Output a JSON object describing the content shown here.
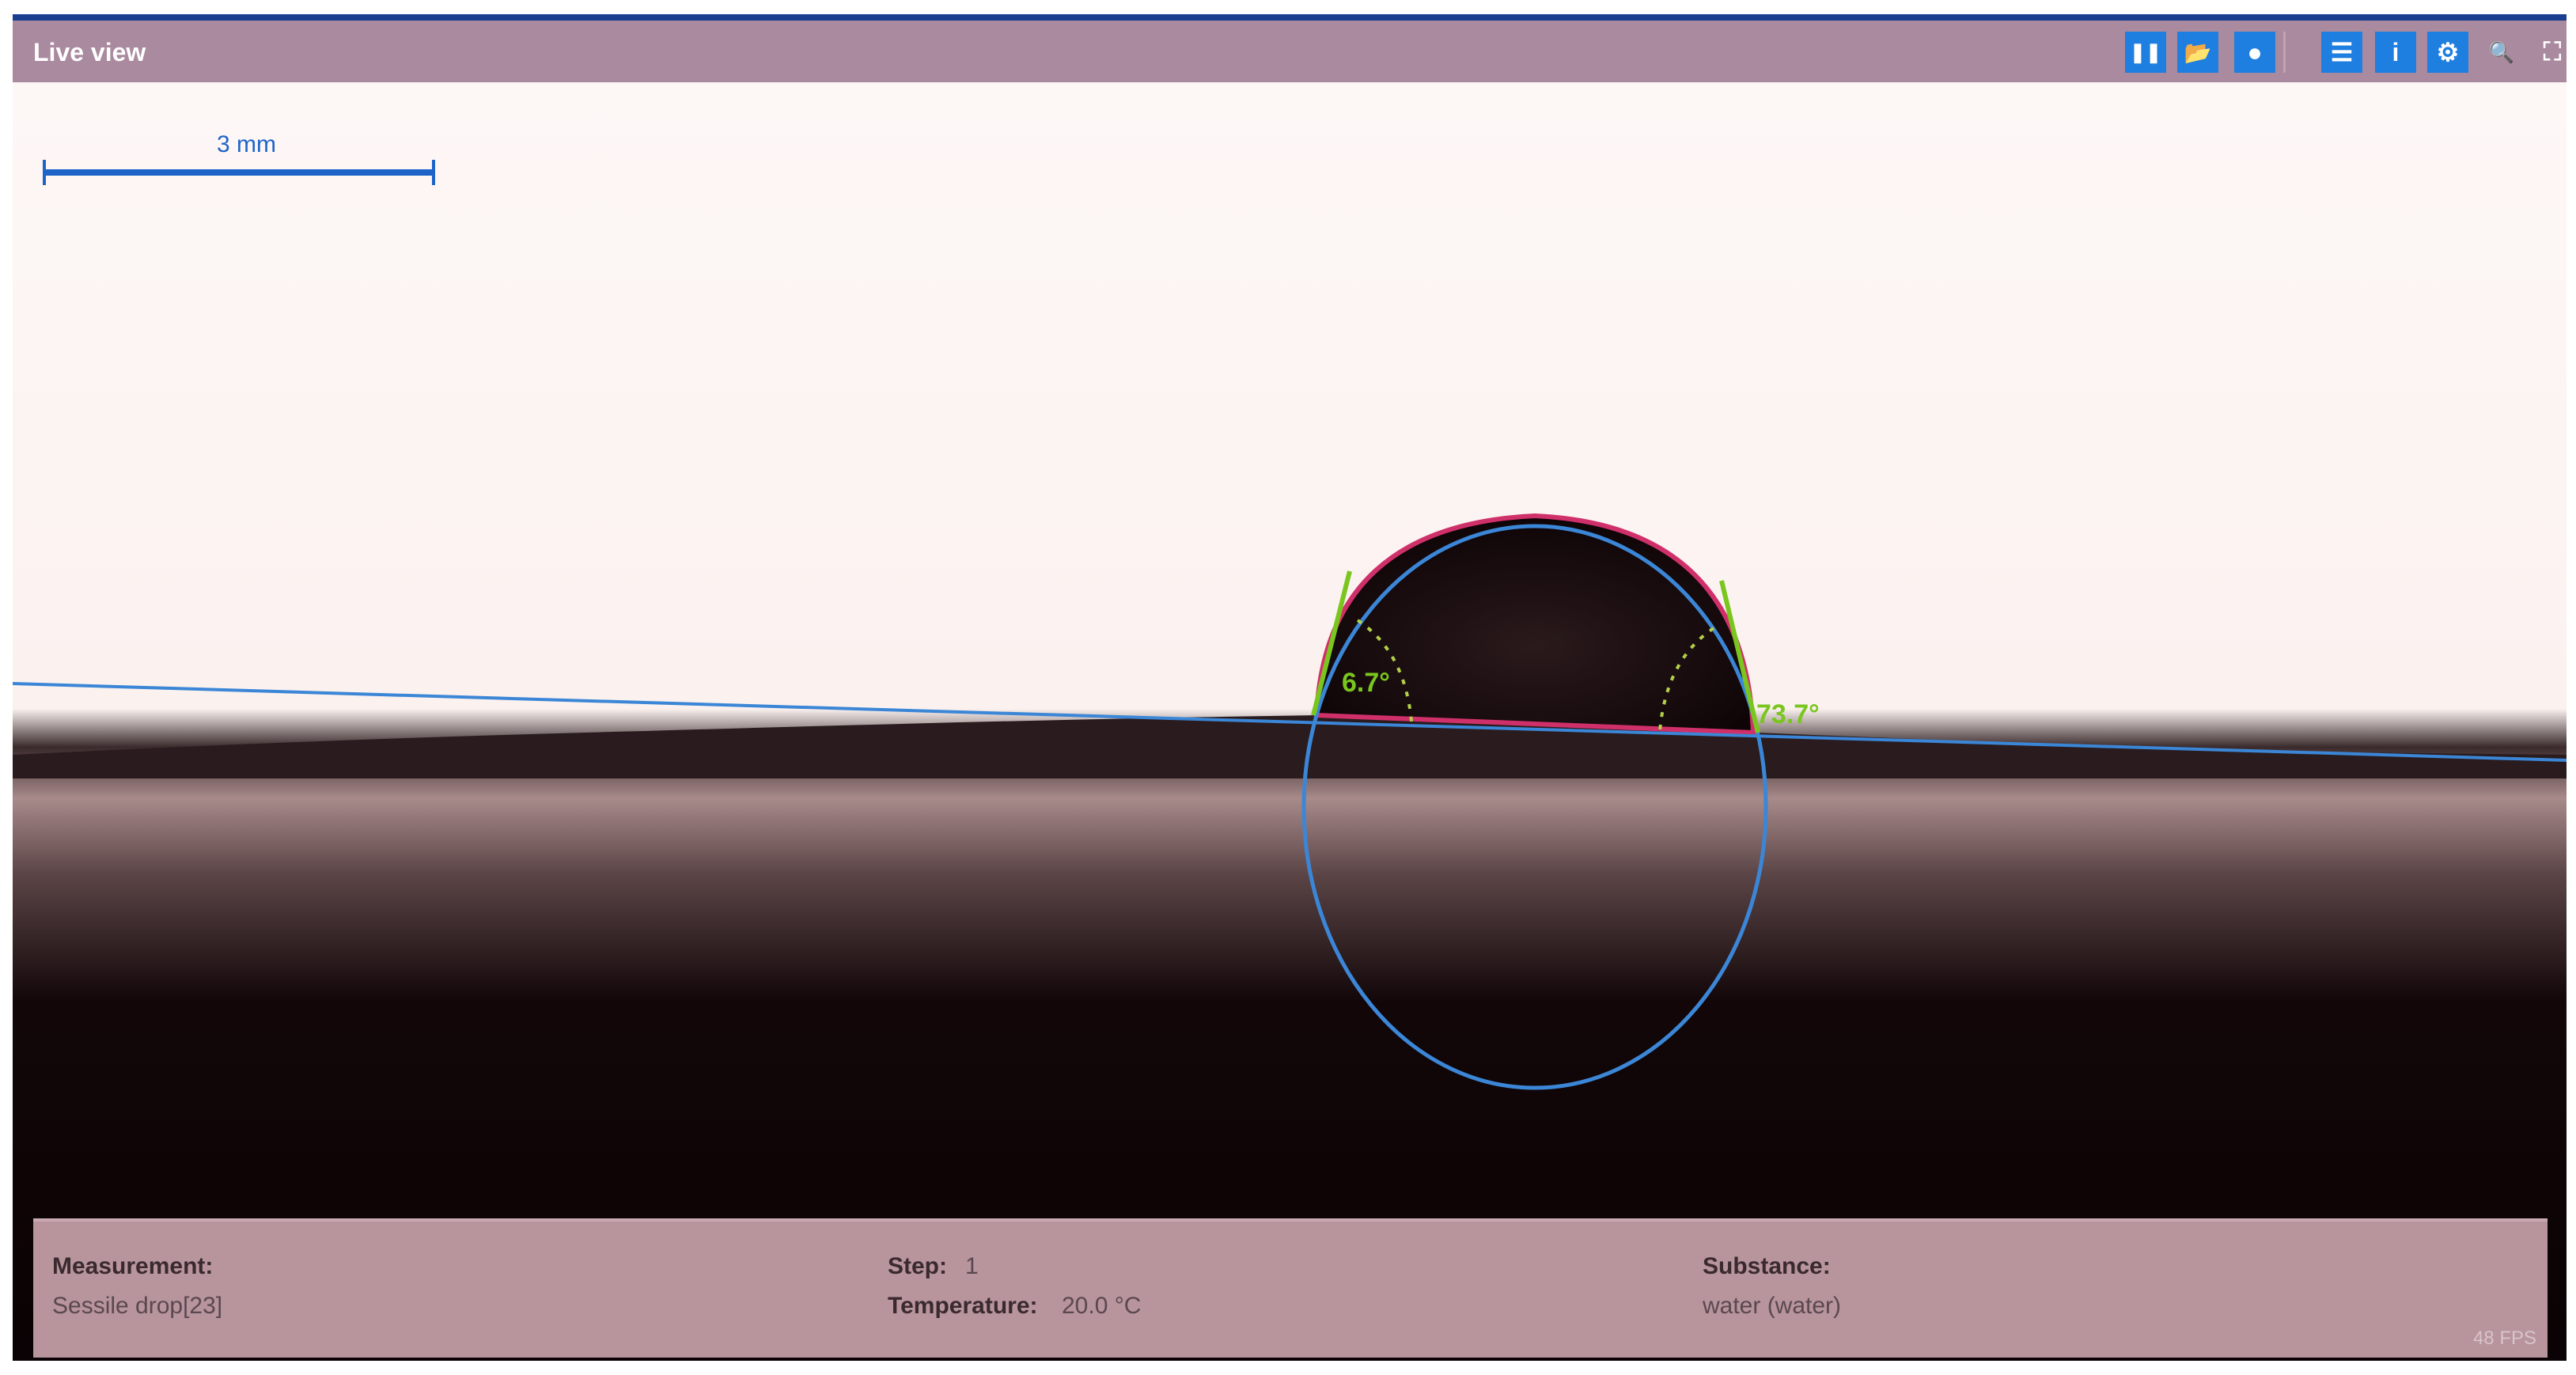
{
  "window": {
    "title": "Live view"
  },
  "toolbar": {
    "buttons": [
      {
        "icon": "pause-icon",
        "glyph": "❚❚"
      },
      {
        "icon": "open-folder-icon",
        "glyph": "📂"
      },
      {
        "icon": "record-icon",
        "glyph": "●"
      },
      {
        "icon": "baseline-icon",
        "glyph": "☰"
      },
      {
        "icon": "info-icon",
        "glyph": "i"
      },
      {
        "icon": "settings-gear-icon",
        "glyph": "⚙"
      },
      {
        "icon": "zoom-icon",
        "glyph": "🔍"
      },
      {
        "icon": "fit-screen-icon",
        "glyph": "⛶"
      }
    ]
  },
  "image": {
    "scale_bar_label": "3 mm",
    "left_angle": "6.7°",
    "right_angle": "73.7°"
  },
  "info_panel": {
    "measurement_label": "Measurement:",
    "measurement_value": "Sessile drop[23]",
    "step_label": "Step:",
    "step_value": "1",
    "temperature_label": "Temperature:",
    "temperature_value": "20.0 °C",
    "substance_label": "Substance:",
    "substance_value": "water (water)",
    "fps": "48 FPS"
  },
  "colors": {
    "titlebar": "#a98a9e",
    "accent": "#1f7fe0",
    "angle": "#7ac61e",
    "fit": "#3b86d6"
  }
}
